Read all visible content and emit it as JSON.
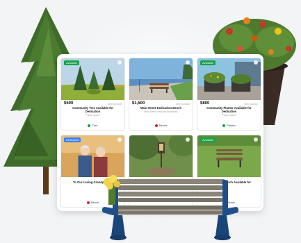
{
  "listings": [
    {
      "badge": "Available",
      "price": "$500",
      "subid": "Item #10428",
      "title_line1": "Community Tree Available for",
      "title_line2": "Dedication",
      "location": "Public Space",
      "type": "Tree",
      "type_color": "green"
    },
    {
      "badge": "",
      "price": "$1,500",
      "subid": "Item #10422",
      "title_line1": "Main Street Dedication Bench",
      "title_line2": "",
      "location": "Main Street Seaside Boardwalk",
      "type": "Bench",
      "type_color": "red"
    },
    {
      "badge": "Available",
      "price": "$800",
      "subid": "Item #10461",
      "title_line1": "Community Planter Available for",
      "title_line2": "Dedication",
      "location": "Public Space",
      "type": "Planter",
      "type_color": "green"
    },
    {
      "badge": "Dedicated",
      "price": "",
      "subid": "",
      "title_line1": "To Our Loving Grandparents",
      "title_line2": "",
      "location": "",
      "type": "Bench",
      "type_color": "red"
    },
    {
      "badge": "",
      "price": "",
      "subid": "",
      "title_line1": "",
      "title_line2": "",
      "location": "",
      "type": "",
      "type_color": "red"
    },
    {
      "badge": "Available",
      "price": "",
      "subid": "",
      "title_line1": "Community Bench Available for",
      "title_line2": "",
      "location": "",
      "type": "Bench",
      "type_color": "red"
    }
  ]
}
